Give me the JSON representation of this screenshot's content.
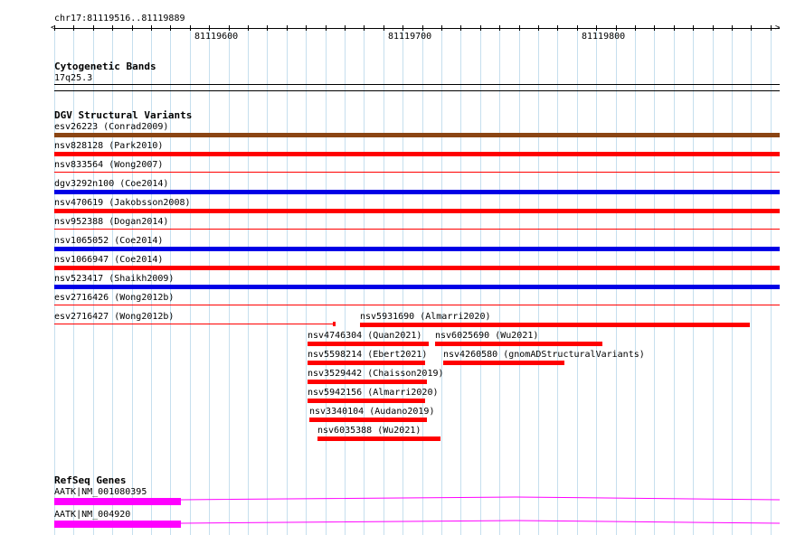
{
  "ruler": {
    "locus": "chr17:81119516..81119889",
    "tick_labels": [
      "81119600",
      "81119700",
      "81119800"
    ]
  },
  "cytoband": {
    "title": "Cytogenetic Bands",
    "band": "17q25.3"
  },
  "dgv": {
    "title": "DGV Structural Variants",
    "colors": {
      "brown": "#8b4513",
      "red": "#ff0000",
      "blue": "#0000e6"
    },
    "full_rows": [
      {
        "label": "esv26223 (Conrad2009)",
        "color": "brown",
        "style": "thick"
      },
      {
        "label": "nsv828128 (Park2010)",
        "color": "red",
        "style": "thick"
      },
      {
        "label": "nsv833564 (Wong2007)",
        "color": "red",
        "style": "thin"
      },
      {
        "label": "dgv3292n100 (Coe2014)",
        "color": "blue",
        "style": "thick"
      },
      {
        "label": "nsv470619 (Jakobsson2008)",
        "color": "red",
        "style": "thick"
      },
      {
        "label": "nsv952388 (Dogan2014)",
        "color": "red",
        "style": "thin"
      },
      {
        "label": "nsv1065052 (Coe2014)",
        "color": "blue",
        "style": "thick"
      },
      {
        "label": "nsv1066947 (Coe2014)",
        "color": "red",
        "style": "thick"
      },
      {
        "label": "nsv523417 (Shaikh2009)",
        "color": "blue",
        "style": "thick"
      },
      {
        "label": "esv2716426 (Wong2012b)",
        "color": "red",
        "style": "thin"
      }
    ],
    "partial": {
      "esv2716427": "esv2716427 (Wong2012b)",
      "nsv5931690": "nsv5931690 (Almarri2020)",
      "nsv4746304": "nsv4746304 (Quan2021)",
      "nsv6025690": "nsv6025690 (Wu2021)",
      "nsv5598214": "nsv5598214 (Ebert2021)",
      "nsv4260580": "nsv4260580 (gnomADStructuralVariants)",
      "nsv3529442": "nsv3529442 (Chaisson2019)",
      "nsv5942156": "nsv5942156 (Almarri2020)",
      "nsv3340104": "nsv3340104 (Audano2019)",
      "nsv6035388": "nsv6035388 (Wu2021)"
    }
  },
  "refseq": {
    "title": "RefSeq Genes",
    "color": "#ff00ff",
    "genes": [
      {
        "label": "AATK|NM_001080395"
      },
      {
        "label": "AATK|NM_004920"
      }
    ]
  }
}
